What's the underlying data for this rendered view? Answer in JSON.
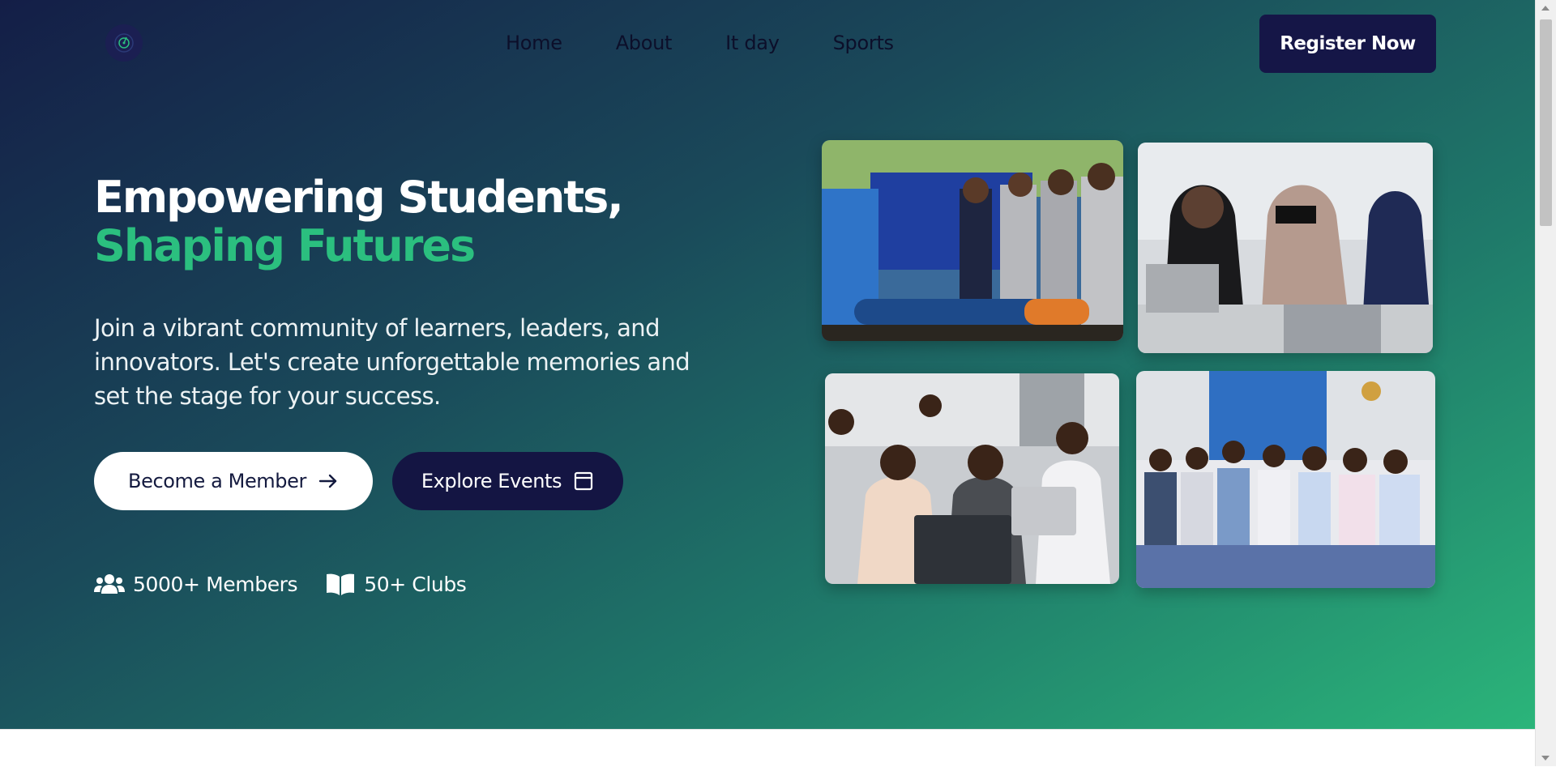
{
  "nav": {
    "logo_icon": "target-icon",
    "items": [
      {
        "label": "Home"
      },
      {
        "label": "About"
      },
      {
        "label": "It day"
      },
      {
        "label": "Sports"
      }
    ],
    "register_label": "Register Now"
  },
  "hero": {
    "headline_line1": "Empowering Students,",
    "headline_line2": "Shaping Futures",
    "subtext": "Join a vibrant community of learners, leaders, and innovators. Let's create unforgettable memories and set the stage for your success.",
    "primary_button": {
      "label": "Become a Member",
      "icon": "arrow-right-icon"
    },
    "secondary_button": {
      "label": "Explore Events",
      "icon": "calendar-icon"
    },
    "stats": [
      {
        "icon": "users-icon",
        "label": "5000+ Members"
      },
      {
        "icon": "book-open-icon",
        "label": "50+ Clubs"
      }
    ]
  },
  "gallery": [
    {
      "id": "photo-handshake"
    },
    {
      "id": "photo-women-laptops"
    },
    {
      "id": "photo-students-class"
    },
    {
      "id": "photo-audience"
    }
  ],
  "colors": {
    "accent_green": "#2bbf7f",
    "navy": "#151647",
    "gradient_start": "#141e47",
    "gradient_end": "#2bb57a"
  }
}
